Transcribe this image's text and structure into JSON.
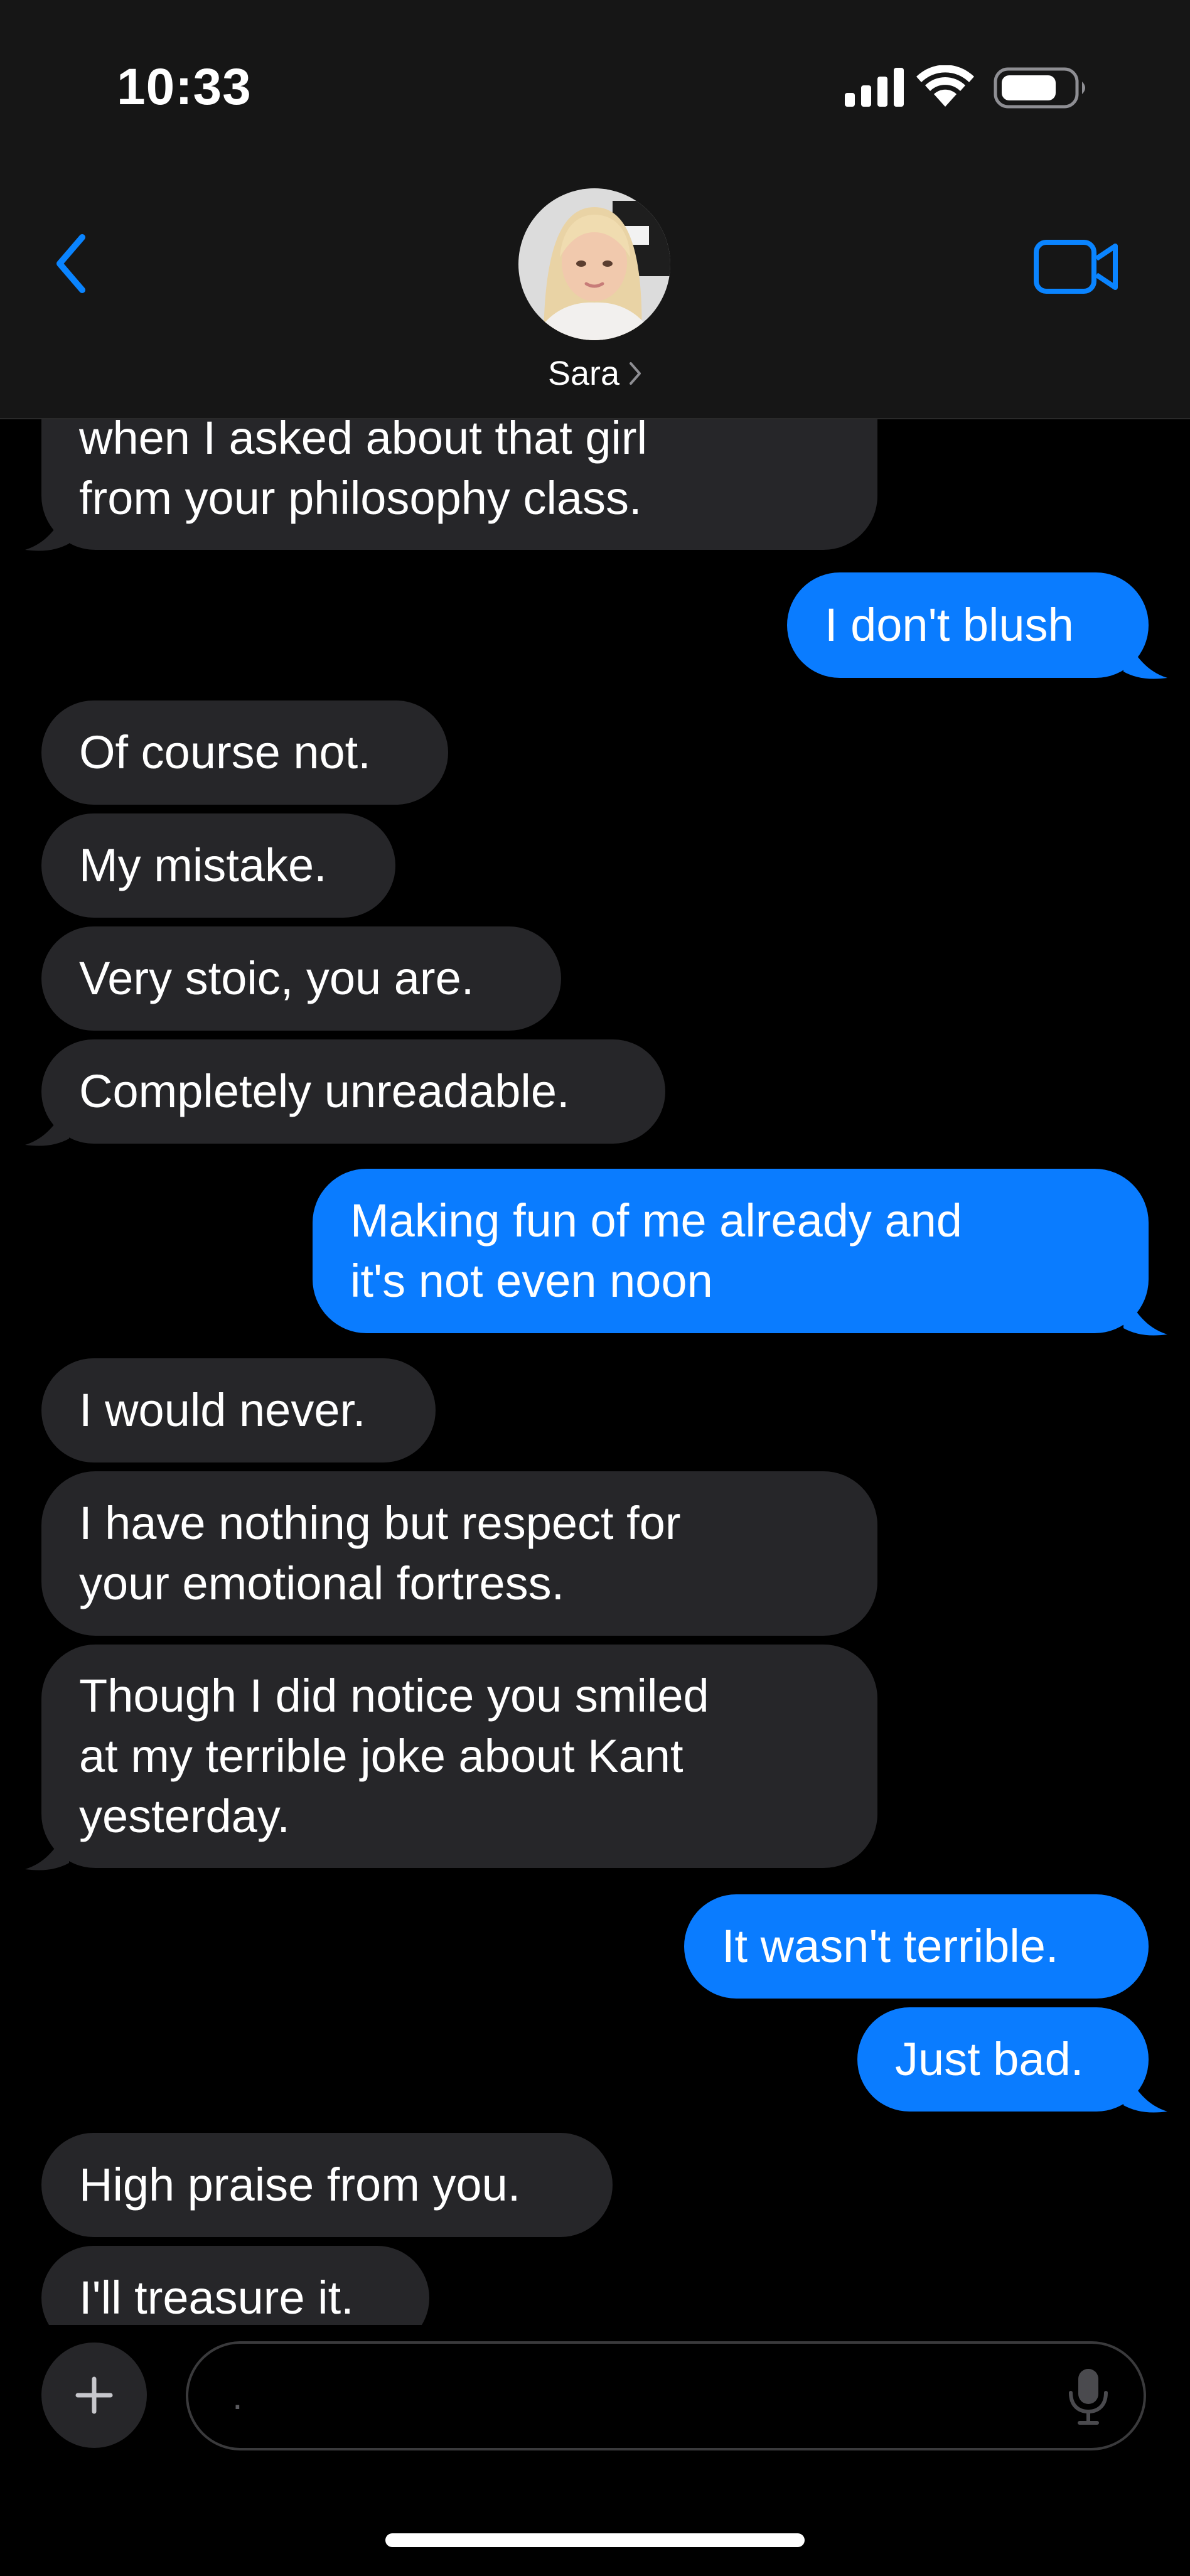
{
  "status_bar": {
    "time": "10:33",
    "icons": [
      "cellular-signal-icon",
      "wifi-icon",
      "battery-icon"
    ]
  },
  "header": {
    "back_icon": "chevron-left-icon",
    "contact_name": "Sara",
    "contact_chevron": "›",
    "video_icon": "video-camera-icon"
  },
  "messages": [
    {
      "sender": "contact",
      "lines": [
        "when I asked about that girl",
        "from your philosophy class."
      ]
    },
    {
      "sender": "me",
      "lines": [
        "I don't blush"
      ]
    },
    {
      "sender": "contact",
      "lines": [
        "Of course not."
      ]
    },
    {
      "sender": "contact",
      "lines": [
        "My mistake."
      ]
    },
    {
      "sender": "contact",
      "lines": [
        "Very stoic, you are."
      ]
    },
    {
      "sender": "contact",
      "lines": [
        "Completely unreadable."
      ]
    },
    {
      "sender": "me",
      "lines": [
        "Making fun of me already and",
        "it's not even noon"
      ]
    },
    {
      "sender": "contact",
      "lines": [
        "I would never."
      ]
    },
    {
      "sender": "contact",
      "lines": [
        "I have nothing but respect for",
        "your emotional fortress."
      ]
    },
    {
      "sender": "contact",
      "lines": [
        "Though I did notice you smiled",
        "at my terrible joke about Kant",
        "yesterday."
      ]
    },
    {
      "sender": "me",
      "lines": [
        "It wasn't terrible."
      ]
    },
    {
      "sender": "me",
      "lines": [
        "Just bad."
      ]
    },
    {
      "sender": "contact",
      "lines": [
        "High praise from you."
      ]
    },
    {
      "sender": "contact",
      "lines": [
        "I'll treasure it."
      ]
    }
  ],
  "composer": {
    "plus_icon": "plus-icon",
    "input_value": "",
    "placeholder": ".",
    "mic_icon": "microphone-icon"
  },
  "colors": {
    "outgoing_bubble": "#0a7cff",
    "incoming_bubble": "#262629",
    "accent": "#0a84ff",
    "background": "#000000",
    "header_background": "#161616"
  }
}
